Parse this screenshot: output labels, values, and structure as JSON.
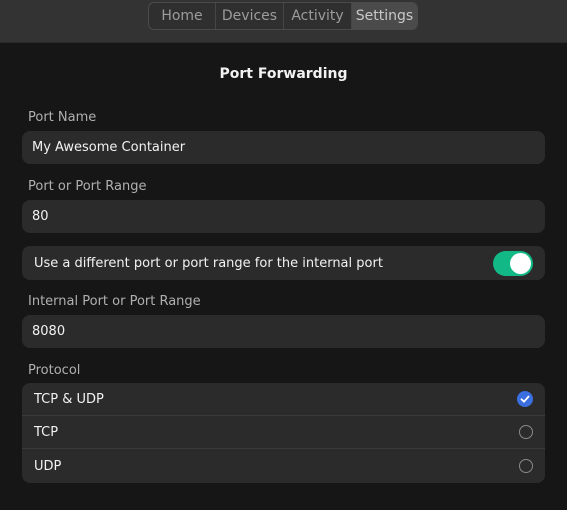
{
  "tabs": [
    {
      "label": "Home",
      "active": false
    },
    {
      "label": "Devices",
      "active": false
    },
    {
      "label": "Activity",
      "active": false
    },
    {
      "label": "Settings",
      "active": true
    }
  ],
  "page_title": "Port Forwarding",
  "form": {
    "port_name": {
      "label": "Port Name",
      "value": "My Awesome Container"
    },
    "port_range": {
      "label": "Port or Port Range",
      "value": "80"
    },
    "internal_toggle": {
      "label": "Use a different port or port range for the internal port",
      "on": true
    },
    "internal_port": {
      "label": "Internal Port or Port Range",
      "value": "8080"
    },
    "protocol": {
      "label": "Protocol",
      "options": [
        {
          "label": "TCP & UDP",
          "selected": true
        },
        {
          "label": "TCP",
          "selected": false
        },
        {
          "label": "UDP",
          "selected": false
        }
      ]
    }
  },
  "colors": {
    "accent_toggle": "#12b886",
    "accent_radio": "#3b6fe0",
    "background": "#161616",
    "field_bg": "#2b2b2b"
  },
  "icons": {
    "selected_radio": "checkmark-icon",
    "unselected_radio": "radio-circle-icon"
  }
}
